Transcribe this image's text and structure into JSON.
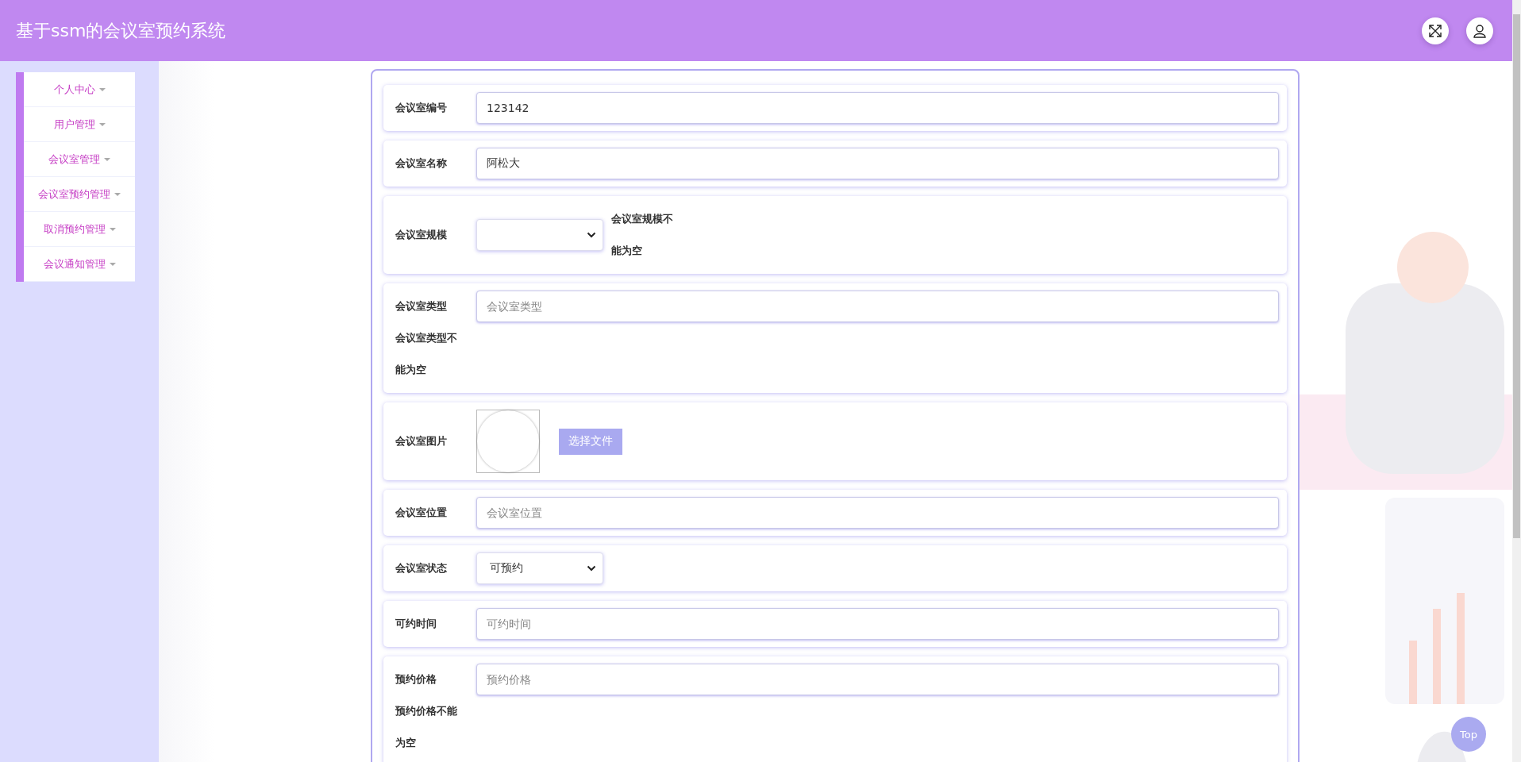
{
  "header": {
    "title": "基于ssm的会议室预约系统"
  },
  "sidebar": {
    "items": [
      {
        "label": "个人中心"
      },
      {
        "label": "用户管理"
      },
      {
        "label": "会议室管理"
      },
      {
        "label": "会议室预约管理"
      },
      {
        "label": "取消预约管理"
      },
      {
        "label": "会议通知管理"
      }
    ]
  },
  "form": {
    "fields": [
      {
        "kind": "text",
        "label": "会议室编号",
        "value": "123142"
      },
      {
        "kind": "text",
        "label": "会议室名称",
        "value": "阿松大"
      },
      {
        "kind": "select",
        "label": "会议室规模",
        "error": "会议室规模不能为空"
      },
      {
        "kind": "text",
        "label": "会议室类型",
        "placeholder": "会议室类型",
        "error": "会议室类型不能为空"
      },
      {
        "kind": "image",
        "label": "会议室图片",
        "button": "选择文件"
      },
      {
        "kind": "text",
        "label": "会议室位置",
        "placeholder": "会议室位置"
      },
      {
        "kind": "select",
        "label": "会议室状态",
        "value": "可预约"
      },
      {
        "kind": "text",
        "label": "可约时间",
        "placeholder": "可约时间"
      },
      {
        "kind": "text",
        "label": "预约价格",
        "placeholder": "预约价格",
        "error": "预约价格不能为空"
      }
    ]
  },
  "back_to_top": "Top"
}
